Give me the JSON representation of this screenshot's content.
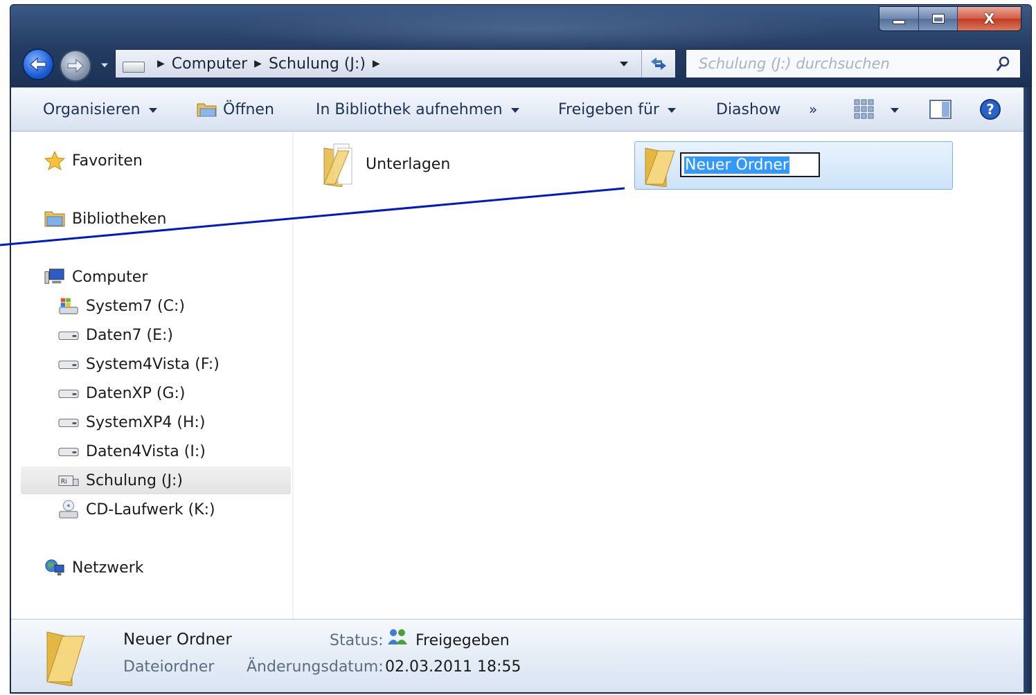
{
  "window": {
    "caption_buttons": {
      "minimize": "",
      "maximize": "",
      "close": "X"
    }
  },
  "navigation": {
    "breadcrumb": [
      "Computer",
      "Schulung (J:)"
    ],
    "search": {
      "placeholder": "Schulung (J:) durchsuchen"
    }
  },
  "command_bar": {
    "organize": "Organisieren",
    "open": "Öffnen",
    "include_library": "In Bibliothek aufnehmen",
    "share_with": "Freigeben für",
    "slideshow": "Diashow",
    "more": "»"
  },
  "nav_pane": {
    "favorites": "Favoriten",
    "libraries": "Bibliotheken",
    "computer": "Computer",
    "drives": [
      {
        "label": "System7 (C:)",
        "icon": "windows-drive-icon"
      },
      {
        "label": "Daten7 (E:)",
        "icon": "hard-drive-icon"
      },
      {
        "label": "System4Vista (F:)",
        "icon": "hard-drive-icon"
      },
      {
        "label": "DatenXP (G:)",
        "icon": "hard-drive-icon"
      },
      {
        "label": "SystemXP4 (H:)",
        "icon": "hard-drive-icon"
      },
      {
        "label": "Daten4Vista (I:)",
        "icon": "hard-drive-icon"
      },
      {
        "label": "Schulung (J:)",
        "icon": "removable-drive-icon",
        "selected": true
      },
      {
        "label": "CD-Laufwerk (K:)",
        "icon": "cd-drive-icon"
      }
    ],
    "network": "Netzwerk"
  },
  "files": [
    {
      "name": "Unterlagen",
      "icon": "folder-with-documents-icon"
    },
    {
      "name": "Neuer Ordner",
      "icon": "folder-icon",
      "renaming": true
    }
  ],
  "details": {
    "name": "Neuer Ordner",
    "type": "Dateiordner",
    "status_label": "Status:",
    "status_value": "Freigegeben",
    "modified_label": "Änderungsdatum:",
    "modified_value": "02.03.2011 18:55"
  },
  "colors": {
    "frame": "#1d3458",
    "selection": "#3399ff",
    "annotation_line": "#0018c8",
    "folder": "#f0cf6e"
  }
}
